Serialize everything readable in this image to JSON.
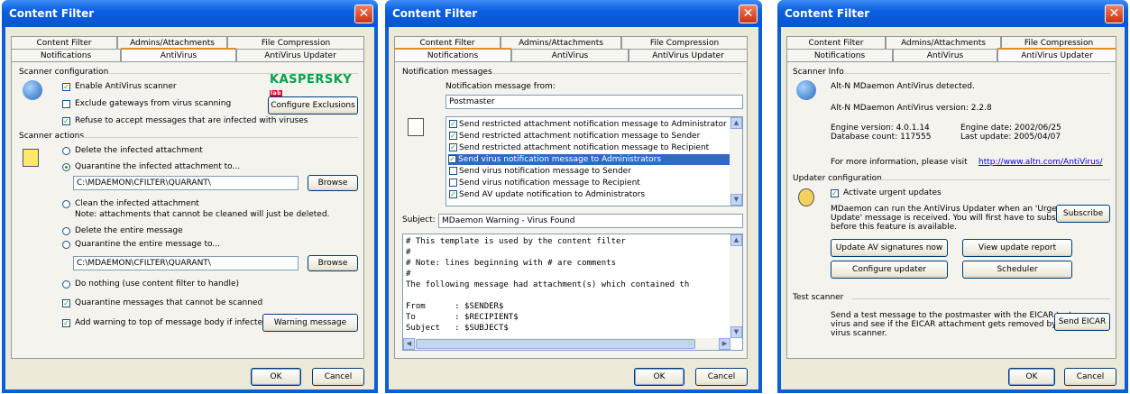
{
  "windows": [
    {
      "title": "Content Filter",
      "tabs_row1": [
        "Content Filter",
        "Admins/Attachments",
        "File Compression"
      ],
      "tabs_row2": [
        "Notifications",
        "AntiVirus",
        "AntiVirus Updater"
      ],
      "active_tab": "AntiVirus",
      "scanner_config": {
        "heading": "Scanner configuration",
        "logo": "KASPERSKY",
        "logo_badge": "lab",
        "enable": {
          "label": "Enable AntiVirus scanner",
          "checked": true
        },
        "exclude": {
          "label": "Exclude gateways from virus scanning",
          "checked": false
        },
        "refuse": {
          "label": "Refuse to accept messages that are infected with viruses",
          "checked": true
        },
        "configure_btn": "Configure Exclusions"
      },
      "scanner_actions": {
        "heading": "Scanner actions",
        "delete_att": "Delete the infected attachment",
        "quarantine_att": "Quarantine the infected attachment to...",
        "path1": "C:\\MDAEMON\\CFILTER\\QUARANT\\",
        "browse": "Browse",
        "clean_att": "Clean the infected attachment",
        "clean_note": "Note: attachments that cannot be cleaned will just be deleted.",
        "delete_msg": "Delete the entire message",
        "quarantine_msg": "Quarantine the entire message to...",
        "path2": "C:\\MDAEMON\\CFILTER\\QUARANT\\",
        "do_nothing": "Do nothing (use content filter to handle)",
        "quar_unscanned": "Quarantine messages that cannot be scanned",
        "add_warning": "Add warning to top of message body if infected",
        "warning_btn": "Warning message"
      },
      "ok": "OK",
      "cancel": "Cancel"
    },
    {
      "title": "Content Filter",
      "tabs_row1": [
        "Content Filter",
        "Admins/Attachments",
        "File Compression"
      ],
      "tabs_row2": [
        "Notifications",
        "AntiVirus",
        "AntiVirus Updater"
      ],
      "active_tab": "Notifications",
      "heading": "Notification messages",
      "from_label": "Notification message from:",
      "from_value": "Postmaster",
      "list": [
        {
          "label": "Send restricted attachment notification message to Administrator",
          "checked": true
        },
        {
          "label": "Send restricted attachment notification message to Sender",
          "checked": true
        },
        {
          "label": "Send restricted attachment notification message to Recipient",
          "checked": true
        },
        {
          "label": "Send virus notification message to Administrators",
          "checked": true
        },
        {
          "label": "Send virus notification message to Sender",
          "checked": false
        },
        {
          "label": "Send virus notification message to Recipient",
          "checked": false
        },
        {
          "label": "Send AV update notification to Administrators",
          "checked": true
        }
      ],
      "subject_label": "Subject:",
      "subject_value": "MDaemon Warning - Virus Found",
      "template_lines": [
        "# This template is used by the content filter",
        "#",
        "# Note: lines beginning with # are comments",
        "#",
        "The following message had attachment(s) which contained th",
        "",
        "From      : $SENDER$",
        "To        : $RECIPIENT$",
        "Subject   : $SUBJECT$"
      ],
      "ok": "OK",
      "cancel": "Cancel"
    },
    {
      "title": "Content Filter",
      "tabs_row1": [
        "Content Filter",
        "Admins/Attachments",
        "File Compression"
      ],
      "tabs_row2": [
        "Notifications",
        "AntiVirus",
        "AntiVirus Updater"
      ],
      "active_tab": "AntiVirus Updater",
      "scanner_info": {
        "heading": "Scanner Info",
        "detected": "Alt-N MDaemon AntiVirus detected.",
        "version": "Alt-N MDaemon AntiVirus version: 2.2.8",
        "engine_version": "Engine version: 4.0.1.14",
        "db_count": "Database count: 117555",
        "engine_date": "Engine date: 2002/06/25",
        "last_update": "Last update: 2005/04/07",
        "more_info": "For more information, please visit",
        "url": "http://www.altn.com/AntiVirus/"
      },
      "updater": {
        "heading": "Updater configuration",
        "activate": {
          "label": "Activate urgent updates",
          "checked": true
        },
        "desc1": "MDaemon can run the AntiVirus Updater when an 'Urgent",
        "desc2": "Update' message is received.  You will first have to subscribe",
        "desc3": "before this feature is available.",
        "subscribe": "Subscribe",
        "update_now": "Update AV signatures now",
        "view_report": "View update report",
        "configure": "Configure updater",
        "scheduler": "Scheduler"
      },
      "test": {
        "heading": "Test scanner",
        "desc1": "Send a test message to the postmaster with the EICAR test",
        "desc2": "virus and see if the EICAR attachment gets removed by the",
        "desc3": "virus scanner.",
        "send": "Send EICAR"
      },
      "ok": "OK",
      "cancel": "Cancel"
    }
  ]
}
